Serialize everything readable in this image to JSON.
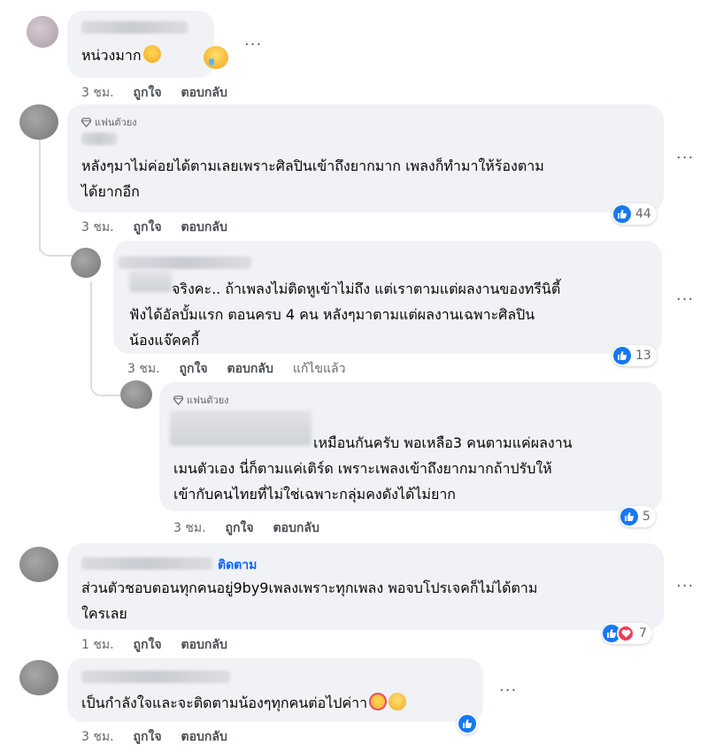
{
  "comments": [
    {
      "text": "หน่วงมาก",
      "time": "3 ชม.",
      "like": "ถูกใจ",
      "reply": "ตอบกลับ"
    },
    {
      "badge": "แฟนตัวยง",
      "text_line1": "หลังๆมาไม่ค่อยได้ตามเลยเพราะศิลปินเข้าถึงยากมาก เพลงก็ทำมาให้ร้องตาม",
      "text_line2": "ได้ยากอีก",
      "time": "3 ชม.",
      "like": "ถูกใจ",
      "reply": "ตอบกลับ",
      "reaction_count": "44"
    },
    {
      "text_line1": "จริงคะ.. ถ้าเพลงไม่ติดหูเข้าไม่ถึง แต่เราตามแต่ผลงานของทรีนิตี้",
      "text_line2": "ฟังได้อัลบั้มแรก ตอนครบ 4 คน หลังๆมาตามแต่ผลงานเฉพาะศิลปิน",
      "text_line3": "น้องแจ๊คคกี้",
      "time": "3 ชม.",
      "like": "ถูกใจ",
      "reply": "ตอบกลับ",
      "edited": "แก้ไขแล้ว",
      "reaction_count": "13"
    },
    {
      "badge": "แฟนตัวยง",
      "text_line1": "เหมือนกันครับ พอเหลือ3 คนตามแค่ผลงาน",
      "text_line2": "เมนตัวเอง นี่ก็ตามแค่เติร์ด เพราะเพลงเข้าถึงยากมากถ้าปรับให้",
      "text_line3": "เข้ากับคนไทยที่ไม่ใช่เฉพาะกลุ่มคงดังได้ไม่ยาก",
      "time": "3 ชม.",
      "like": "ถูกใจ",
      "reply": "ตอบกลับ",
      "reaction_count": "5"
    },
    {
      "follow": "ติดตาม",
      "text_line1": "ส่วนตัวชอบตอนทุกคนอยู่9by9เพลงเพราะทุกเพลง พอจบโปรเจคก็ไม่ได้ตาม",
      "text_line2": "ใครเลย",
      "time": "1 ชม.",
      "like": "ถูกใจ",
      "reply": "ตอบกลับ",
      "reaction_count": "7"
    },
    {
      "text": "เป็นกำลังใจและจะติดตามน้องๆทุกคนต่อไปค่าา",
      "time": "3 ชม.",
      "like": "ถูกใจ",
      "reply": "ตอบกลับ"
    }
  ],
  "icons": {
    "more": "more-options-icon",
    "like": "like-reaction-icon",
    "love": "love-reaction-icon",
    "fan": "diamond-icon"
  },
  "colors": {
    "bubble": "#f0f2f5",
    "like_blue": "#1877f2",
    "love_red": "#f33e58",
    "follow_blue": "#0866ff"
  }
}
